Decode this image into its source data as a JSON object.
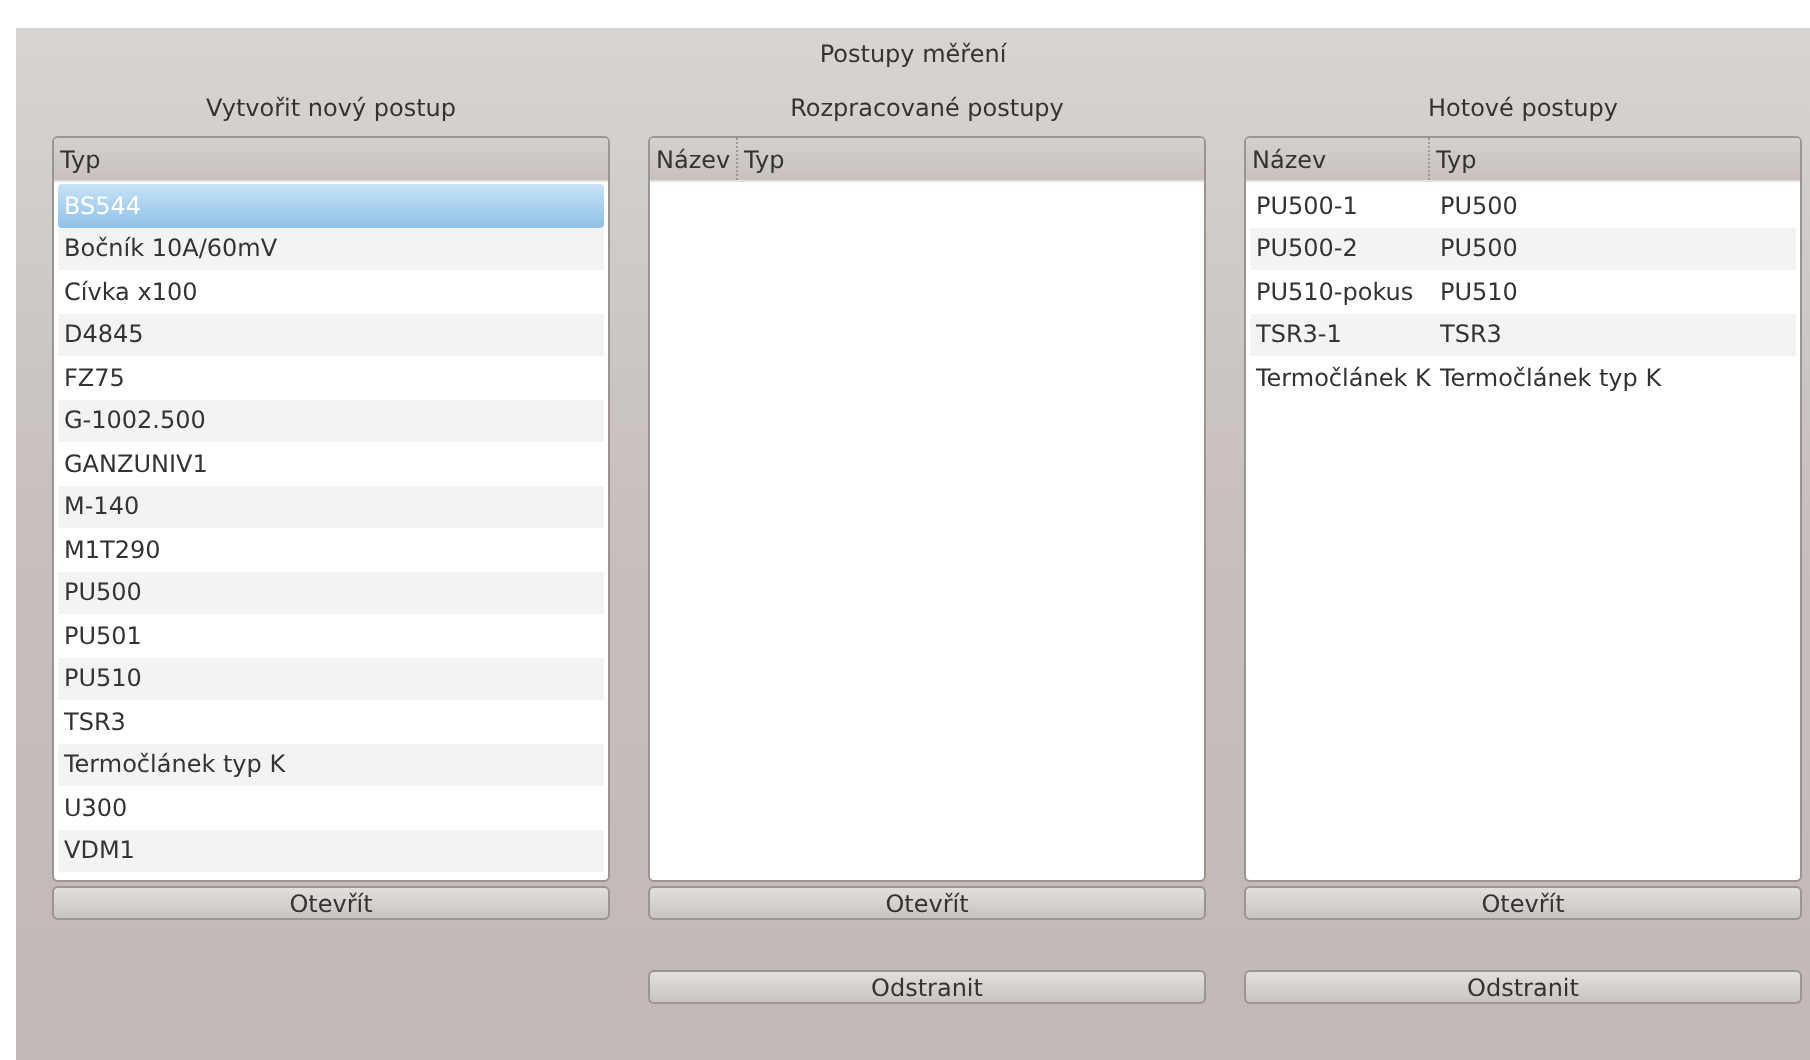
{
  "window": {
    "title": "Postupy měření"
  },
  "panels": [
    {
      "heading": "Vytvořit nový postup",
      "columns": [
        "Typ"
      ],
      "rows": [
        {
          "cells": [
            "BS544"
          ],
          "selected": true
        },
        {
          "cells": [
            "Bočník 10A/60mV"
          ],
          "selected": false
        },
        {
          "cells": [
            "Cívka x100"
          ],
          "selected": false
        },
        {
          "cells": [
            "D4845"
          ],
          "selected": false
        },
        {
          "cells": [
            "FZ75"
          ],
          "selected": false
        },
        {
          "cells": [
            "G-1002.500"
          ],
          "selected": false
        },
        {
          "cells": [
            "GANZUNIV1"
          ],
          "selected": false
        },
        {
          "cells": [
            "M-140"
          ],
          "selected": false
        },
        {
          "cells": [
            "M1T290"
          ],
          "selected": false
        },
        {
          "cells": [
            "PU500"
          ],
          "selected": false
        },
        {
          "cells": [
            "PU501"
          ],
          "selected": false
        },
        {
          "cells": [
            "PU510"
          ],
          "selected": false
        },
        {
          "cells": [
            "TSR3"
          ],
          "selected": false
        },
        {
          "cells": [
            "Termočlánek typ K"
          ],
          "selected": false
        },
        {
          "cells": [
            "U300"
          ],
          "selected": false
        },
        {
          "cells": [
            "VDM1"
          ],
          "selected": false
        }
      ],
      "buttons": [
        "Otevřít"
      ]
    },
    {
      "heading": "Rozpracované postupy",
      "columns": [
        "Název",
        "Typ"
      ],
      "buttons": [
        "Otevřít",
        "Odstranit"
      ]
    },
    {
      "heading": "Hotové postupy",
      "columns": [
        "Název",
        "Typ"
      ],
      "rows": [
        {
          "cells": [
            "PU500-1",
            "PU500"
          ],
          "selected": false
        },
        {
          "cells": [
            "PU500-2",
            "PU500"
          ],
          "selected": false
        },
        {
          "cells": [
            "PU510-pokus",
            "PU510"
          ],
          "selected": false
        },
        {
          "cells": [
            "TSR3-1",
            "TSR3"
          ],
          "selected": false
        },
        {
          "cells": [
            "Termočlánek K",
            "Termočlánek typ K"
          ],
          "selected": false
        }
      ],
      "buttons": [
        "Otevřít",
        "Odstranit"
      ]
    }
  ]
}
